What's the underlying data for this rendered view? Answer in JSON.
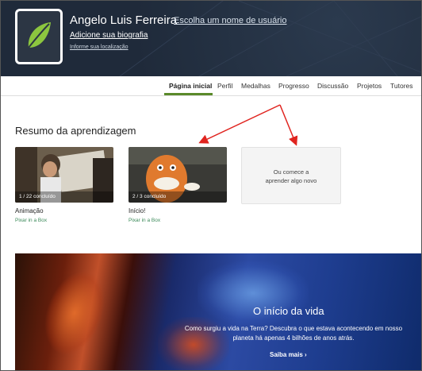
{
  "profile": {
    "name": "Angelo Luis Ferreira",
    "choose_username": "Escolha um nome de usuário",
    "add_bio": "Adicione sua biografia",
    "add_location": "Informe sua localização"
  },
  "nav": {
    "tabs": [
      "Página inicial",
      "Perfil",
      "Medalhas",
      "Progresso",
      "Discussão",
      "Projetos",
      "Tutores"
    ],
    "active_index": 0
  },
  "section": {
    "title": "Resumo da aprendizagem"
  },
  "cards": [
    {
      "progress": "1 / 22 concluído",
      "title": "Animação",
      "subtitle": "Pixar in a Box"
    },
    {
      "progress": "2 / 3 concluído",
      "title": "Início!",
      "subtitle": "Pixar in a Box"
    }
  ],
  "empty_card": {
    "line1": "Ou comece a",
    "line2": "aprender algo novo"
  },
  "banner": {
    "title": "O início da vida",
    "desc_line1": "Como surgiu a vida na Terra? Descubra o que estava acontecendo em nosso",
    "desc_line2": "planeta há apenas 4 bilhões de anos atrás.",
    "link": "Saiba mais ›"
  },
  "colors": {
    "header_bg": "#1f2a3a",
    "accent_green": "#5a8a2a",
    "subtitle_green": "#3c8a5a",
    "arrow_red": "#e0241f"
  },
  "icons": {
    "avatar": "leaf-icon"
  }
}
